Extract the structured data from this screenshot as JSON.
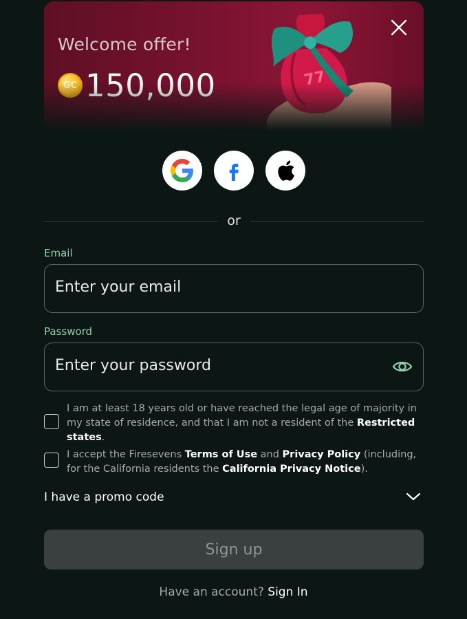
{
  "banner": {
    "title": "Welcome offer!",
    "coin_label": "GC",
    "amount": "150,000",
    "gift_logo_text": "77"
  },
  "social": {
    "providers": [
      "google-icon",
      "facebook-icon",
      "apple-icon"
    ]
  },
  "divider": {
    "text": "or"
  },
  "email": {
    "label": "Email",
    "placeholder": "Enter your email"
  },
  "password": {
    "label": "Password",
    "placeholder": "Enter your password"
  },
  "consent_age": {
    "text_before": "I am at least 18 years old or have reached the legal age of majority in my state of residence, and that I am not a resident of the ",
    "link": "Restricted states",
    "text_after": "."
  },
  "consent_terms": {
    "text_1": "I accept the Firesevens ",
    "link_terms": "Terms of Use",
    "text_2": " and ",
    "link_privacy": "Privacy Policy",
    "text_3": " (including, for the California residents the ",
    "link_ca": "California Privacy Notice",
    "text_4": ")."
  },
  "promo": {
    "label": "I have a promo code"
  },
  "signup": {
    "label": "Sign up"
  },
  "footer": {
    "question": "Have an account? ",
    "link": "Sign In"
  },
  "colors": {
    "background": "#0c1614",
    "accent_label": "#8fd1b0",
    "banner": "#7a1230",
    "button_disabled": "#3a403f"
  }
}
